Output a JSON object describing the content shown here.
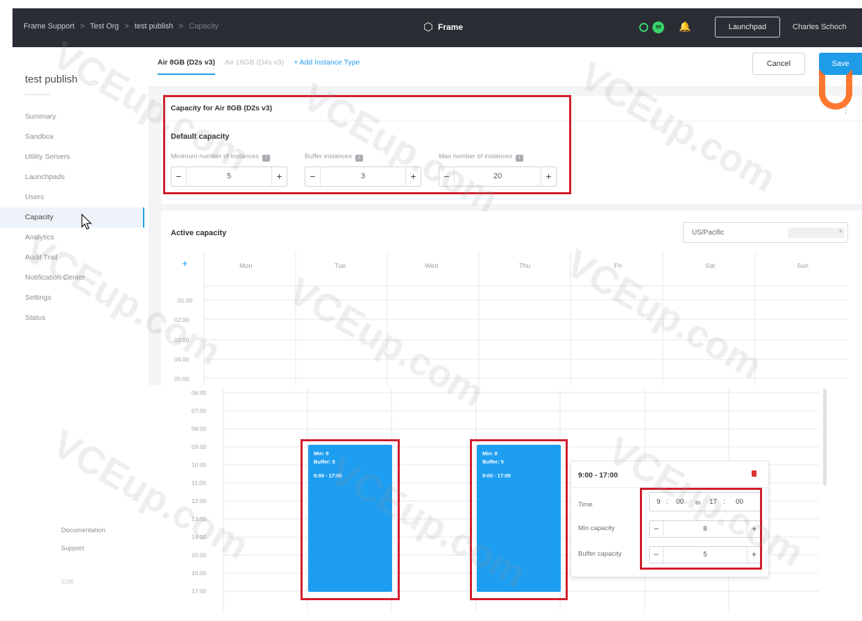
{
  "topbar": {
    "breadcrumb": [
      "Frame Support",
      "Test Org",
      "test publish",
      "Capacity"
    ],
    "breadcrumb_separator": ">",
    "brand": "Frame",
    "status_badge": "99",
    "launchpad_button": "Launchpad",
    "user_name": "Charles Schoch"
  },
  "sidebar": {
    "app_name": "test publish",
    "items": [
      "Summary",
      "Sandbox",
      "Utility Servers",
      "Launchpads",
      "Users",
      "Capacity",
      "Analytics",
      "Audit Trail",
      "Notification Center",
      "Settings",
      "Status"
    ],
    "active_item": "Capacity",
    "footer_links": [
      "Documentation",
      "Support"
    ],
    "version": "2108"
  },
  "instance_tabs": {
    "active": "Air 8GB (D2s v3)",
    "faded": "Air 16GB (D4s v3)",
    "add": "+ Add Instance Type"
  },
  "actions": {
    "cancel": "Cancel",
    "save": "Save"
  },
  "capacity_card": {
    "title": "Capacity for Air 8GB (D2s v3)",
    "section": "Default capacity",
    "fields": [
      {
        "label": "Minimum number of instances",
        "value": "5"
      },
      {
        "label": "Buffer instances",
        "value": "3"
      },
      {
        "label": "Max number of instances",
        "value": "20"
      }
    ],
    "minus": "−",
    "plus": "+"
  },
  "active_capacity": {
    "title": "Active capacity",
    "timezone": "US/Pacific",
    "add_symbol": "+",
    "days": [
      "Mon",
      "Tue",
      "Wed",
      "Thu",
      "Fri",
      "Sat",
      "Sun"
    ],
    "hours_top": [
      "01:00",
      "02:00",
      "03:00",
      "04:00",
      "05:00"
    ],
    "hours_bottom": [
      "06:00",
      "07:00",
      "08:00",
      "09:00",
      "10:00",
      "11:00",
      "12:00",
      "13:00",
      "14:00",
      "15:00",
      "16:00",
      "17:00"
    ]
  },
  "schedule_blocks": [
    {
      "day": "Tue",
      "min": "Min: 8",
      "buffer": "Buffer: 5",
      "time": "9:00 - 17:00"
    },
    {
      "day": "Thu",
      "min": "Min: 8",
      "buffer": "Buffer: 5",
      "time": "9:00 - 17:00"
    }
  ],
  "popover": {
    "title": "9:00 - 17:00",
    "time_label": "Time",
    "start_hour": "9",
    "start_min": "00",
    "to": "to",
    "end_hour": "17",
    "end_min": "00",
    "min_label": "Min capacity",
    "min_value": "8",
    "buffer_label": "Buffer capacity",
    "buffer_value": "5"
  },
  "watermark": "VCEup.com",
  "colors": {
    "accent": "#1f9ce8",
    "highlight": "#d11c2a",
    "topbar": "#2a2d33",
    "status": "#3ad36b"
  }
}
